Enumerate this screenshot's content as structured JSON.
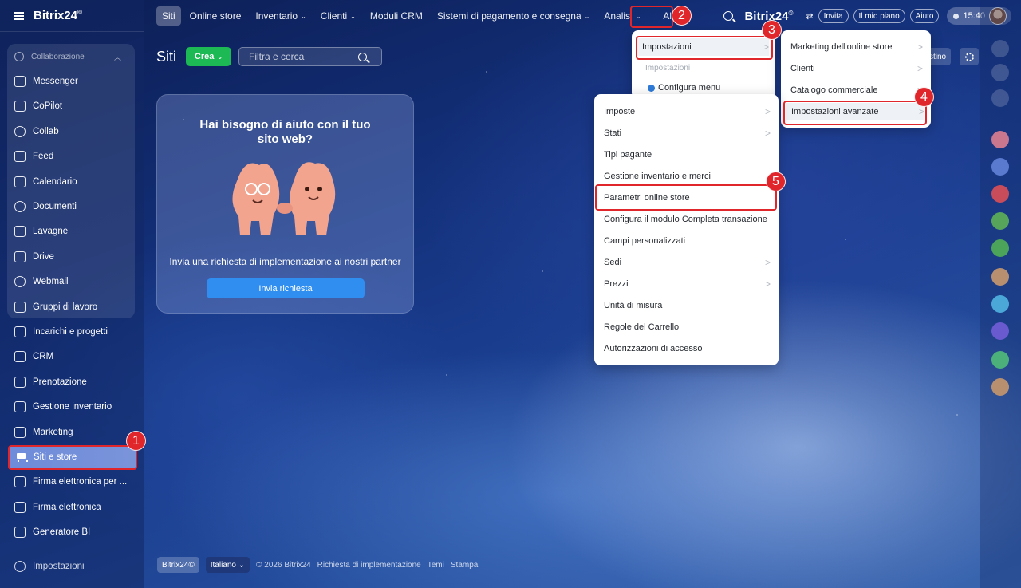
{
  "app": {
    "logo": "Bitrix24",
    "logo_mark": "©"
  },
  "topnav": {
    "tabs": [
      {
        "label": "Siti",
        "dropdown": false,
        "selected": true
      },
      {
        "label": "Online store",
        "dropdown": false
      },
      {
        "label": "Inventario",
        "dropdown": true
      },
      {
        "label": "Clienti",
        "dropdown": true
      },
      {
        "label": "Moduli CRM",
        "dropdown": false
      },
      {
        "label": "Sistemi di pagamento e consegna",
        "dropdown": true
      },
      {
        "label": "Analisi",
        "dropdown": true
      },
      {
        "label": "Altro",
        "dropdown": true
      }
    ],
    "dropdown_caret": "⌄"
  },
  "topright": {
    "brand": "Bitrix24",
    "brand_mark": "©",
    "invite": "Invita",
    "plan": "Il mio piano",
    "help": "Aiuto",
    "time": "15:40"
  },
  "sidebar": {
    "group_label": "Collaborazione",
    "group_items": [
      {
        "label": "Messenger",
        "icon": "chat-icon"
      },
      {
        "label": "CoPilot",
        "icon": "copilot-icon"
      },
      {
        "label": "Collab",
        "icon": "collab-icon"
      },
      {
        "label": "Feed",
        "icon": "feed-icon"
      },
      {
        "label": "Calendario",
        "icon": "calendar-icon"
      },
      {
        "label": "Documenti",
        "icon": "document-icon"
      },
      {
        "label": "Lavagne",
        "icon": "board-icon"
      },
      {
        "label": "Drive",
        "icon": "drive-icon"
      },
      {
        "label": "Webmail",
        "icon": "mail-icon"
      },
      {
        "label": "Gruppi di lavoro",
        "icon": "groups-icon"
      }
    ],
    "items": [
      {
        "label": "Incarichi e progetti",
        "icon": "tasks-icon"
      },
      {
        "label": "CRM",
        "icon": "crm-icon"
      },
      {
        "label": "Prenotazione",
        "icon": "booking-icon"
      },
      {
        "label": "Gestione inventario",
        "icon": "inventory-icon"
      },
      {
        "label": "Marketing",
        "icon": "marketing-icon"
      },
      {
        "label": "Siti e store",
        "icon": "cart-icon",
        "active": true
      },
      {
        "label": "Firma elettronica per ...",
        "icon": "sign-icon"
      },
      {
        "label": "Firma elettronica",
        "icon": "signature-icon"
      },
      {
        "label": "Generatore BI",
        "icon": "bi-icon"
      }
    ],
    "settings": "Impostazioni"
  },
  "page": {
    "title": "Siti",
    "create_button": "Crea",
    "filter_placeholder": "Filtra e cerca",
    "partial_button": "stino"
  },
  "help_card": {
    "title": "Hai bisogno di aiuto con il tuo sito web?",
    "text": "Invia una richiesta di implementazione ai nostri partner",
    "button": "Invia richiesta"
  },
  "menu_altro": {
    "impostazioni": "Impostazioni",
    "section_label": "Impostazioni",
    "configure": "Configura menu"
  },
  "menu_impostazioni_sub": [
    {
      "label": "Marketing dell'online store",
      "arrow": true
    },
    {
      "label": "Clienti",
      "arrow": true
    },
    {
      "label": "Catalogo commerciale",
      "arrow": true
    },
    {
      "label": "Impostazioni avanzate",
      "arrow": true
    }
  ],
  "menu_avanzate": [
    {
      "label": "Imposte",
      "arrow": true
    },
    {
      "label": "Stati",
      "arrow": true
    },
    {
      "label": "Tipi pagante",
      "arrow": false
    },
    {
      "label": "Gestione inventario e merci",
      "arrow": false
    },
    {
      "label": "Parametri online store",
      "arrow": false
    },
    {
      "label": "Configura il modulo Completa transazione",
      "arrow": false
    },
    {
      "label": "Campi personalizzati",
      "arrow": false
    },
    {
      "label": "Sedi",
      "arrow": true
    },
    {
      "label": "Prezzi",
      "arrow": true
    },
    {
      "label": "Unità di misura",
      "arrow": false
    },
    {
      "label": "Regole del Carrello",
      "arrow": false
    },
    {
      "label": "Autorizzazioni di accesso",
      "arrow": false
    }
  ],
  "menu_arrow": ">",
  "annotations": [
    "1",
    "2",
    "3",
    "4",
    "5"
  ],
  "footer": {
    "brand": "Bitrix24",
    "language": "Italiano",
    "copyright": "© 2026 Bitrix24",
    "links": [
      "Richiesta di implementazione",
      "Temi",
      "Stampa"
    ]
  },
  "colors": {
    "accent_green": "#1db954",
    "accent_blue": "#2f8ef0",
    "annotation_red": "#e0262b"
  }
}
